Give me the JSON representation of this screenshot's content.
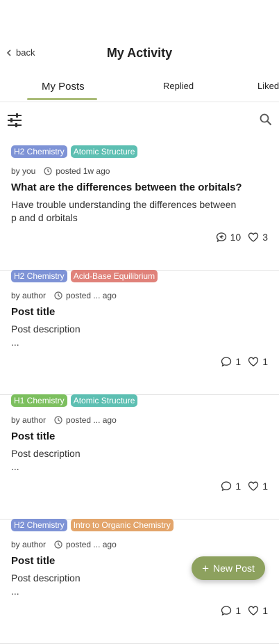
{
  "header": {
    "back_label": "back",
    "title": "My Activity"
  },
  "tabs": [
    "My Posts",
    "Replied",
    "Liked"
  ],
  "colors": {
    "accent": "#a9bb77",
    "fab": "#8da15e"
  },
  "posts": [
    {
      "tags": [
        {
          "label": "H2 Chemistry",
          "color": "#7e93d6"
        },
        {
          "label": "Atomic Structure",
          "color": "#5dbfb2"
        }
      ],
      "author": "by you",
      "time": "posted 1w ago",
      "title": "What are the differences between the orbitals?",
      "description": "Have trouble understanding the differences between\np and d orbitals",
      "comments": "10",
      "likes": "3",
      "comment_icon": "comment-replied-icon"
    },
    {
      "tags": [
        {
          "label": "H2 Chemistry",
          "color": "#7e93d6"
        },
        {
          "label": "Acid-Base Equilibrium",
          "color": "#e0827a"
        }
      ],
      "author": "by author",
      "time": "posted ... ago",
      "title": "Post title",
      "description": "Post description\n...",
      "comments": "1",
      "likes": "1",
      "comment_icon": "comment-icon"
    },
    {
      "tags": [
        {
          "label": "H1 Chemistry",
          "color": "#7cbf5e"
        },
        {
          "label": "Atomic Structure",
          "color": "#5dbfb2"
        }
      ],
      "author": "by author",
      "time": "posted ... ago",
      "title": "Post title",
      "description": "Post description\n...",
      "comments": "1",
      "likes": "1",
      "comment_icon": "comment-icon"
    },
    {
      "tags": [
        {
          "label": "H2 Chemistry",
          "color": "#7e93d6"
        },
        {
          "label": "Intro to Organic Chemistry",
          "color": "#e3a56b"
        }
      ],
      "author": "by author",
      "time": "posted ... ago",
      "title": "Post title",
      "description": "Post description\n...",
      "comments": "1",
      "likes": "1",
      "comment_icon": "comment-icon"
    }
  ],
  "fab": {
    "label": "New Post"
  }
}
